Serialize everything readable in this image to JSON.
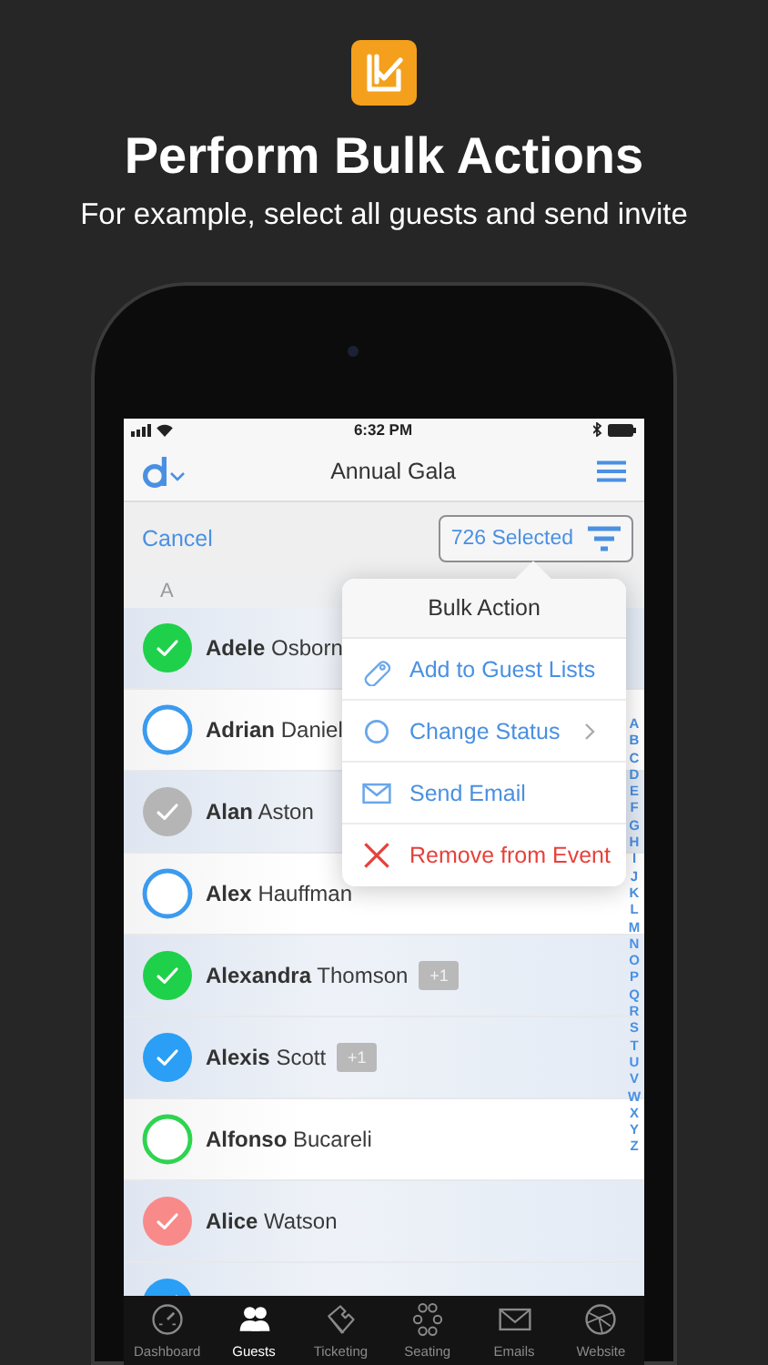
{
  "promo": {
    "title": "Perform Bulk Actions",
    "subtitle": "For example, select all guests and send invite"
  },
  "status_bar": {
    "time": "6:32 PM"
  },
  "nav_bar": {
    "title": "Annual Gala"
  },
  "toolbar": {
    "cancel": "Cancel",
    "selection": "726 Selected"
  },
  "section": "A",
  "guests": [
    {
      "name": "**Adele** Osborn",
      "checked": true,
      "color": "#1fd14a"
    },
    {
      "name": "**Adrian** Daniel",
      "checked": false,
      "color": "#3a9bf0"
    },
    {
      "name": "**Alan** Aston",
      "checked": true,
      "color": "#b5b5b5"
    },
    {
      "name": "**Alex** Hauffman",
      "checked": false,
      "color": "#3a9bf0"
    },
    {
      "name": "**Alexandra** Thomson",
      "checked": true,
      "color": "#1fd14a",
      "badge": "+1"
    },
    {
      "name": "**Alexis** Scott",
      "checked": true,
      "color": "#2a9ff5",
      "badge": "+1"
    },
    {
      "name": "**Alfonso** Bucareli",
      "checked": false,
      "color": "#2ed450"
    },
    {
      "name": "**Alice** Watson",
      "checked": true,
      "color": "#f98a8a"
    },
    {
      "checked": true,
      "color": "#2a9ff5"
    }
  ],
  "index_letters": [
    "A",
    "B",
    "C",
    "D",
    "E",
    "F",
    "G",
    "H",
    "I",
    "J",
    "K",
    "L",
    "M",
    "N",
    "O",
    "P",
    "Q",
    "R",
    "S",
    "T",
    "U",
    "V",
    "W",
    "X",
    "Y",
    "Z"
  ],
  "bulk_menu": {
    "title": "Bulk Action",
    "items": [
      {
        "label": "Add to Guest Lists",
        "kind": "tag",
        "submenu": false
      },
      {
        "label": "Change Status",
        "kind": "status",
        "submenu": true
      },
      {
        "label": "Send Email",
        "kind": "email",
        "submenu": false
      },
      {
        "label": "Remove from Event",
        "kind": "remove",
        "submenu": false
      }
    ]
  },
  "tabs": [
    {
      "label": "Dashboard",
      "kind": "gauge",
      "selected": false
    },
    {
      "label": "Guests",
      "kind": "people",
      "selected": true
    },
    {
      "label": "Ticketing",
      "kind": "ticket",
      "selected": false
    },
    {
      "label": "Seating",
      "kind": "seats",
      "selected": false
    },
    {
      "label": "Emails",
      "kind": "envelope",
      "selected": false
    },
    {
      "label": "Website",
      "kind": "globe",
      "selected": false
    }
  ]
}
